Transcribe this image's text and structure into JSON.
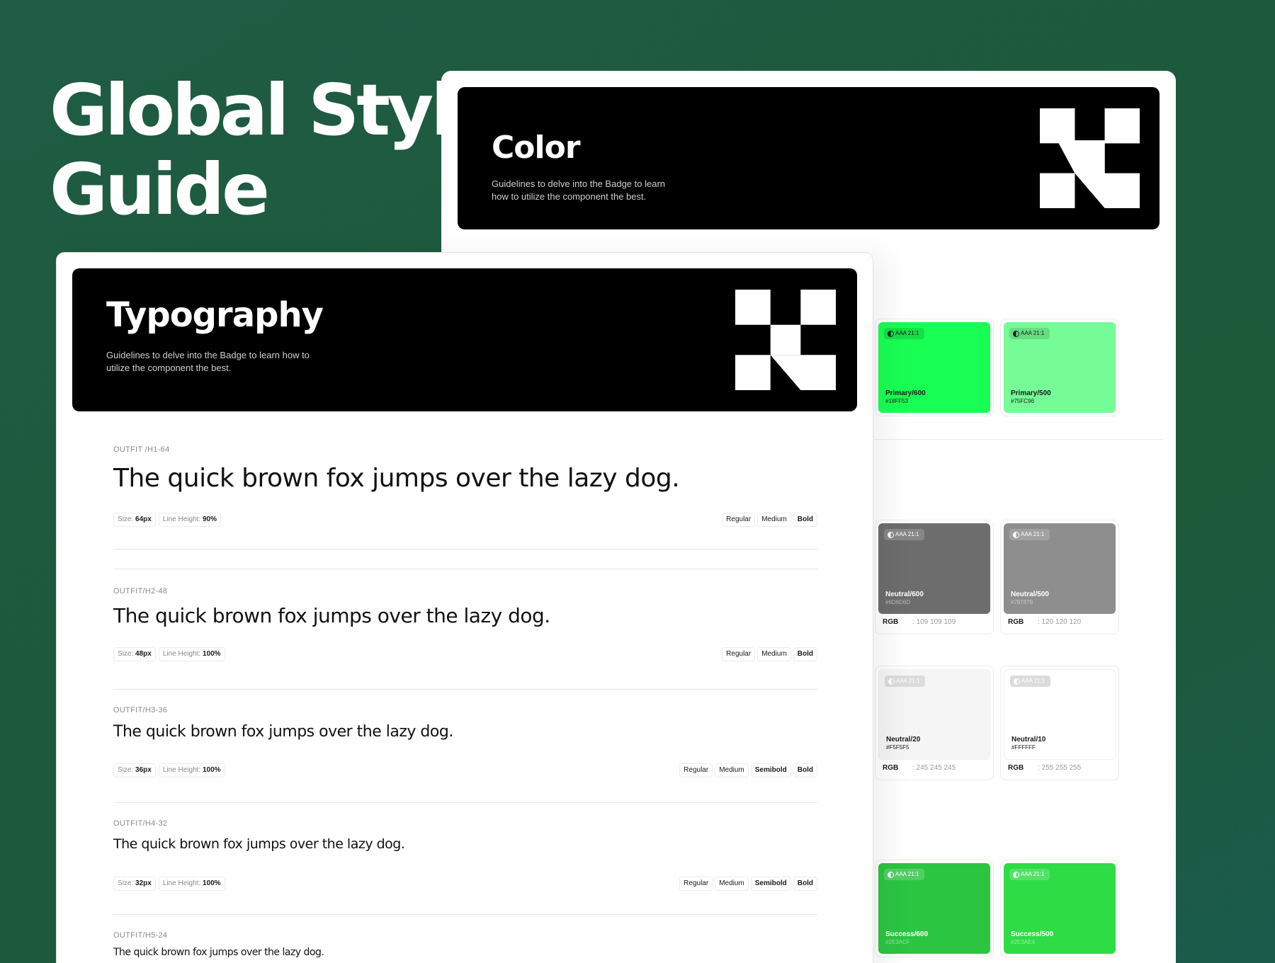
{
  "hero": {
    "line1": "Global Style",
    "line2": "Guide"
  },
  "color_section": {
    "title": "Color",
    "description": "Guidelines to delve into the Badge to learn how to utilize the component the best.",
    "logo_icon": "brand-k-logo-icon",
    "swatches": [
      {
        "name": "Primary/600",
        "hex": "#18FF53",
        "color": "#18FF53",
        "badge": "AAA 21:1",
        "rgb_label": "",
        "rgb": ""
      },
      {
        "name": "Primary/500",
        "hex": "#75FC96",
        "color": "#75FC96",
        "badge": "AAA 21:1",
        "rgb_label": "",
        "rgb": ""
      },
      {
        "name": "Neutral/600",
        "hex": "#6D6D6D",
        "color": "#6D6D6D",
        "badge": "AAA 21:1",
        "rgb_label": "RGB",
        "rgb": ": 109 109 109"
      },
      {
        "name": "Neutral/500",
        "hex": "#787878",
        "color": "#8E8E8E",
        "badge": "AAA 21:1",
        "rgb_label": "RGB",
        "rgb": ": 120 120 120"
      },
      {
        "name": "Neutral/20",
        "hex": "#F5F5F5",
        "color": "#F5F5F5",
        "badge": "AAA 21:1",
        "rgb_label": "RGB",
        "rgb": ": 245 245 245"
      },
      {
        "name": "Neutral/10",
        "hex": "#FFFFFF",
        "color": "#FFFFFF",
        "badge": "AAA 21:1",
        "rgb_label": "RGB",
        "rgb": ": 255 255 255"
      },
      {
        "name": "Success/600",
        "hex": "#2E3ACF",
        "color": "#2CC542",
        "badge": "AAA 21:1",
        "rgb_label": "",
        "rgb": ""
      },
      {
        "name": "Success/500",
        "hex": "#2E3AE4",
        "color": "#2EDC46",
        "badge": "AAA 21:1",
        "rgb_label": "",
        "rgb": ""
      }
    ]
  },
  "typography_section": {
    "title": "Typography",
    "description": "Guidelines to delve into the Badge to learn how to utilize the component the best.",
    "logo_icon": "brand-k-logo-icon",
    "size_label": "Size:",
    "line_height_label": "Line Height:",
    "styles": [
      {
        "label": "OUTFIT /H1-64",
        "sample": "The quick brown fox jumps over the lazy dog.",
        "size": "64px",
        "line_height": "90%",
        "weights": [
          "Regular",
          "Medium",
          "Bold"
        ]
      },
      {
        "label": "OUTFIT/H2-48",
        "sample": "The quick brown fox jumps over the lazy dog.",
        "size": "48px",
        "line_height": "100%",
        "weights": [
          "Regular",
          "Medium",
          "Bold"
        ]
      },
      {
        "label": "OUTFIT/H3-36",
        "sample": "The quick brown fox jumps over the lazy dog.",
        "size": "36px",
        "line_height": "100%",
        "weights": [
          "Regular",
          "Medium",
          "Semibold",
          "Bold"
        ]
      },
      {
        "label": "OUTFIT/H4-32",
        "sample": "The quick brown fox jumps over the lazy dog.",
        "size": "32px",
        "line_height": "100%",
        "weights": [
          "Regular",
          "Medium",
          "Semibold",
          "Bold"
        ]
      },
      {
        "label": "OUTFIT/H5-24",
        "sample": "The quick brown fox jumps over the lazy dog.",
        "size": "",
        "line_height": "",
        "weights": []
      }
    ]
  }
}
